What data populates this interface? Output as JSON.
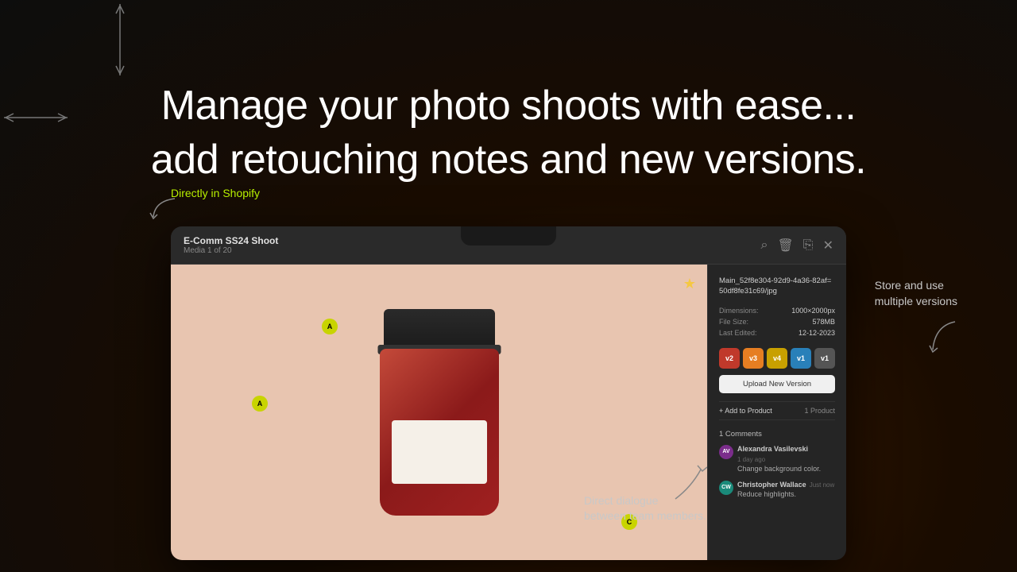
{
  "background": {
    "color": "#1a1008"
  },
  "heading": {
    "line1": "Manage your photo shoots with ease...",
    "line2": "add retouching notes and new versions."
  },
  "labels": {
    "directly": "Directly in Shopify",
    "store": "Store and use\nmultiple versions",
    "dialogue": "Direct dialogue\nbetween team members."
  },
  "window": {
    "title": "E-Comm SS24 Shoot",
    "subtitle": "Media 1 of 20"
  },
  "file_info": {
    "filename": "Main_52f8e304-92d9-4a36-82af=50df8fe31c69/jpg",
    "dimensions_label": "Dimensions:",
    "dimensions_value": "1000×2000px",
    "filesize_label": "File Size:",
    "filesize_value": "578MB",
    "last_edited_label": "Last Edited:",
    "last_edited_value": "12-12-2023"
  },
  "versions": [
    {
      "label": "v2",
      "color": "#c0392b"
    },
    {
      "label": "v3",
      "color": "#e67e22"
    },
    {
      "label": "v4",
      "color": "#c8a000"
    },
    {
      "label": "v1",
      "color": "#2980b9"
    },
    {
      "label": "v1",
      "color": "#555"
    }
  ],
  "buttons": {
    "upload_new_version": "Upload New Version",
    "add_to_product": "+ Add to Product",
    "product_count": "1 Product"
  },
  "comments": {
    "title": "1 Comments",
    "items": [
      {
        "name": "Alexandra Vasilevski",
        "time": "1 day ago",
        "text": "Change background color.",
        "initials": "AV",
        "color": "#7b2d8b"
      },
      {
        "name": "Christopher Wallace",
        "time": "Just now",
        "text": "Reduce highlights.",
        "initials": "CW",
        "color": "#1a8a7a"
      }
    ]
  },
  "pins": [
    {
      "label": "A",
      "position": "top-left"
    },
    {
      "label": "A",
      "position": "mid-left"
    },
    {
      "label": "C",
      "position": "bottom-right"
    }
  ]
}
